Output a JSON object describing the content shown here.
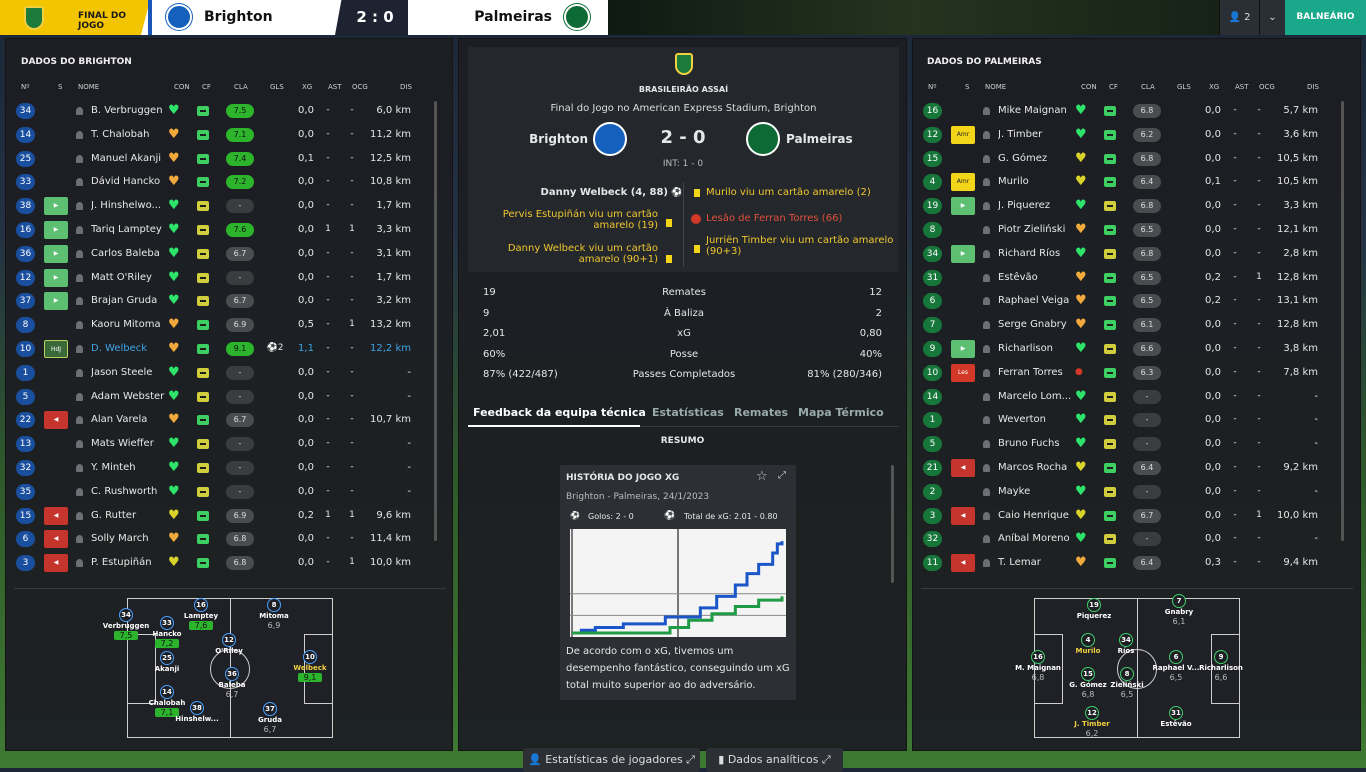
{
  "topbar": {
    "league_label": "FINAL DO JOGO",
    "home": "Brighton",
    "score": "2 : 0",
    "away": "Palmeiras",
    "user_count": "2",
    "balneario": "BALNEÁRIO"
  },
  "colors": {
    "home": "#1560bd",
    "away": "#0d6a35",
    "accent": "#19a88a",
    "league": "#f3c400"
  },
  "home_panel": {
    "title": "DADOS DO BRIGHTON",
    "headers": [
      "Nº",
      "S",
      "NOME",
      "CON",
      "CF",
      "CLA",
      "GLS",
      "XG",
      "AST",
      "OCG",
      "DIS"
    ],
    "rows": [
      {
        "num": "34",
        "sub": "",
        "name": "B. Verbruggen",
        "con": "g",
        "cf": "g",
        "cla": "7.5",
        "gls": "",
        "xg": "0,0",
        "ast": "-",
        "ocg": "-",
        "dis": "6,0 km"
      },
      {
        "num": "14",
        "sub": "",
        "name": "T. Chalobah",
        "con": "o",
        "cf": "g",
        "cla": "7.1",
        "gls": "",
        "xg": "0,0",
        "ast": "-",
        "ocg": "-",
        "dis": "11,2 km"
      },
      {
        "num": "25",
        "sub": "",
        "name": "Manuel Akanji",
        "con": "o",
        "cf": "g",
        "cla": "7.4",
        "gls": "",
        "xg": "0,1",
        "ast": "-",
        "ocg": "-",
        "dis": "12,5 km"
      },
      {
        "num": "33",
        "sub": "",
        "name": "Dávid Hancko",
        "con": "o",
        "cf": "g",
        "cla": "7.2",
        "gls": "",
        "xg": "0,0",
        "ast": "-",
        "ocg": "-",
        "dis": "10,8 km"
      },
      {
        "num": "38",
        "sub": "in",
        "name": "J. Hinshelwo...",
        "con": "g",
        "cf": "y",
        "cla": "-",
        "gls": "",
        "xg": "0,0",
        "ast": "-",
        "ocg": "-",
        "dis": "1,7 km"
      },
      {
        "num": "16",
        "sub": "in",
        "name": "Tariq Lamptey",
        "con": "g",
        "cf": "y",
        "cla": "7.6",
        "gls": "",
        "xg": "0,0",
        "ast": "1",
        "ocg": "1",
        "dis": "3,3 km"
      },
      {
        "num": "36",
        "sub": "in",
        "name": "Carlos Baleba",
        "con": "g",
        "cf": "y",
        "cla": "6.7",
        "gls": "",
        "xg": "0,0",
        "ast": "-",
        "ocg": "-",
        "dis": "3,1 km"
      },
      {
        "num": "12",
        "sub": "in",
        "name": "Matt O'Riley",
        "con": "g",
        "cf": "y",
        "cla": "-",
        "gls": "",
        "xg": "0,0",
        "ast": "-",
        "ocg": "-",
        "dis": "1,7 km"
      },
      {
        "num": "37",
        "sub": "in",
        "name": "Brajan Gruda",
        "con": "g",
        "cf": "y",
        "cla": "6.7",
        "gls": "",
        "xg": "0,0",
        "ast": "-",
        "ocg": "-",
        "dis": "3,2 km"
      },
      {
        "num": "8",
        "sub": "",
        "name": "Kaoru Mitoma",
        "con": "o",
        "cf": "g",
        "cla": "6.9",
        "gls": "",
        "xg": "0,5",
        "ast": "-",
        "ocg": "1",
        "dis": "13,2 km"
      },
      {
        "num": "10",
        "sub": "hdj",
        "name": "D. Welbeck",
        "con": "o",
        "cf": "g",
        "cla": "9.1",
        "gls": "2",
        "xg": "1,1",
        "ast": "-",
        "ocg": "-",
        "dis": "12,2 km",
        "hl": true
      },
      {
        "num": "1",
        "sub": "",
        "name": "Jason Steele",
        "con": "g",
        "cf": "y",
        "cla": "-",
        "gls": "",
        "xg": "0,0",
        "ast": "-",
        "ocg": "-",
        "dis": "-"
      },
      {
        "num": "5",
        "sub": "",
        "name": "Adam Webster",
        "con": "g",
        "cf": "y",
        "cla": "-",
        "gls": "",
        "xg": "0,0",
        "ast": "-",
        "ocg": "-",
        "dis": "-"
      },
      {
        "num": "22",
        "sub": "out",
        "name": "Alan Varela",
        "con": "o",
        "cf": "g",
        "cla": "6.7",
        "gls": "",
        "xg": "0,0",
        "ast": "-",
        "ocg": "-",
        "dis": "10,7 km"
      },
      {
        "num": "13",
        "sub": "",
        "name": "Mats Wieffer",
        "con": "g",
        "cf": "y",
        "cla": "-",
        "gls": "",
        "xg": "0,0",
        "ast": "-",
        "ocg": "-",
        "dis": "-"
      },
      {
        "num": "32",
        "sub": "",
        "name": "Y. Minteh",
        "con": "g",
        "cf": "y",
        "cla": "-",
        "gls": "",
        "xg": "0,0",
        "ast": "-",
        "ocg": "-",
        "dis": "-"
      },
      {
        "num": "35",
        "sub": "",
        "name": "C. Rushworth",
        "con": "g",
        "cf": "y",
        "cla": "-",
        "gls": "",
        "xg": "0,0",
        "ast": "-",
        "ocg": "-",
        "dis": "-"
      },
      {
        "num": "15",
        "sub": "out",
        "name": "G. Rutter",
        "con": "y",
        "cf": "g",
        "cla": "6.9",
        "gls": "",
        "xg": "0,2",
        "ast": "1",
        "ocg": "1",
        "dis": "9,6 km"
      },
      {
        "num": "6",
        "sub": "out",
        "name": "Solly March",
        "con": "o",
        "cf": "g",
        "cla": "6.8",
        "gls": "",
        "xg": "0,0",
        "ast": "-",
        "ocg": "-",
        "dis": "11,4 km"
      },
      {
        "num": "3",
        "sub": "out",
        "name": "P. Estupiñán",
        "con": "y",
        "cf": "g",
        "cla": "6.8",
        "gls": "",
        "xg": "0,0",
        "ast": "-",
        "ocg": "1",
        "dis": "10,0 km"
      }
    ],
    "formation": [
      {
        "num": "34",
        "name": "Verbruggen",
        "rating": "7,5"
      },
      {
        "num": "33",
        "name": "Hancko",
        "rating": "7,2"
      },
      {
        "num": "25",
        "name": "Akanji",
        "rating": ""
      },
      {
        "num": "14",
        "name": "Chalobah",
        "rating": "7,1"
      },
      {
        "num": "16",
        "name": "Lamptey",
        "rating": "7,6"
      },
      {
        "num": "38",
        "name": "Hinshelw...",
        "rating": ""
      },
      {
        "num": "12",
        "name": "O'Riley",
        "rating": ""
      },
      {
        "num": "36",
        "name": "Baleba",
        "rating": "6,7"
      },
      {
        "num": "8",
        "name": "Mitoma",
        "rating": "6,9"
      },
      {
        "num": "37",
        "name": "Gruda",
        "rating": "6,7"
      },
      {
        "num": "10",
        "name": "Welbeck",
        "rating": "9,1"
      }
    ]
  },
  "center": {
    "competition": "BRASILEIRÃO ASSAÍ",
    "venue": "Final do Jogo no American Express Stadium, Brighton",
    "home": "Brighton",
    "away": "Palmeiras",
    "score": "2 - 0",
    "ht": "INT: 1 - 0",
    "events_home": [
      "Danny Welbeck (4, 88)",
      "Pervis Estupiñán viu um cartão amarelo (19)",
      "Danny Welbeck viu um cartão amarelo (90+1)"
    ],
    "events_away": [
      "Murilo viu um cartão amarelo (2)",
      "Lesão de Ferran Torres (66)",
      "Jurriën Timber viu um cartão amarelo (90+3)"
    ],
    "stats": [
      {
        "home": "19",
        "label": "Remates",
        "away": "12"
      },
      {
        "home": "9",
        "label": "À Baliza",
        "away": "2"
      },
      {
        "home": "2,01",
        "label": "xG",
        "away": "0,80"
      },
      {
        "home": "60%",
        "label": "Posse",
        "away": "40%"
      },
      {
        "home": "87% (422/487)",
        "label": "Passes Completados",
        "away": "81% (280/346)"
      }
    ],
    "tabs": [
      "Feedback da equipa técnica",
      "Estatísticas",
      "Remates",
      "Mapa Térmico"
    ],
    "resumo": "RESUMO",
    "card": {
      "title": "HISTÓRIA DO JOGO XG",
      "subtitle": "Brighton - Palmeiras, 24/1/2023",
      "goals": "Golos: 2 - 0",
      "xg_total": "Total de xG: 2.01 - 0.80",
      "text": "De acordo com o xG, tivemos um desempenho fantástico, conseguindo um xG total muito superior ao do adversário."
    },
    "buttons": [
      "Estatísticas de jogadores",
      "Dados analíticos"
    ]
  },
  "chart_data": {
    "type": "line",
    "series": [
      {
        "color": "#1a56c8",
        "x": [
          0,
          4,
          10,
          22,
          40,
          55,
          62,
          70,
          75,
          80,
          86,
          88,
          90
        ],
        "y": [
          0.0,
          0.06,
          0.12,
          0.2,
          0.35,
          0.55,
          0.8,
          1.05,
          1.3,
          1.5,
          1.75,
          1.95,
          2.01
        ]
      },
      {
        "color": "#1f9a45",
        "x": [
          0,
          20,
          42,
          50,
          60,
          70,
          80,
          90
        ],
        "y": [
          0.0,
          0.0,
          0.12,
          0.28,
          0.42,
          0.58,
          0.72,
          0.8
        ]
      }
    ]
  },
  "away_panel": {
    "title": "DADOS DO PALMEIRAS",
    "headers": [
      "Nº",
      "S",
      "NOME",
      "CON",
      "CF",
      "CLA",
      "GLS",
      "XG",
      "AST",
      "OCG",
      "DIS"
    ],
    "rows": [
      {
        "num": "16",
        "sub": "",
        "name": "Mike Maignan",
        "con": "g",
        "cf": "g",
        "cla": "6.8",
        "xg": "0,0",
        "ast": "-",
        "ocg": "-",
        "dis": "5,7 km"
      },
      {
        "num": "12",
        "sub": "amr",
        "name": "J. Timber",
        "con": "g",
        "cf": "g",
        "cla": "6.2",
        "xg": "0,0",
        "ast": "-",
        "ocg": "-",
        "dis": "3,6 km"
      },
      {
        "num": "15",
        "sub": "",
        "name": "G. Gómez",
        "con": "y",
        "cf": "g",
        "cla": "6.8",
        "xg": "0,0",
        "ast": "-",
        "ocg": "-",
        "dis": "10,5 km"
      },
      {
        "num": "4",
        "sub": "amr",
        "name": "Murilo",
        "con": "y",
        "cf": "g",
        "cla": "6.4",
        "xg": "0,1",
        "ast": "-",
        "ocg": "-",
        "dis": "10,5 km"
      },
      {
        "num": "19",
        "sub": "in",
        "name": "J. Piquerez",
        "con": "g",
        "cf": "y",
        "cla": "6.8",
        "xg": "0,0",
        "ast": "-",
        "ocg": "-",
        "dis": "3,3 km"
      },
      {
        "num": "8",
        "sub": "",
        "name": "Piotr Zieliński",
        "con": "o",
        "cf": "g",
        "cla": "6.5",
        "xg": "0,0",
        "ast": "-",
        "ocg": "-",
        "dis": "12,1 km"
      },
      {
        "num": "34",
        "sub": "in",
        "name": "Richard Ríos",
        "con": "g",
        "cf": "y",
        "cla": "6.8",
        "xg": "0,0",
        "ast": "-",
        "ocg": "-",
        "dis": "2,8 km"
      },
      {
        "num": "31",
        "sub": "",
        "name": "Estêvão",
        "con": "o",
        "cf": "g",
        "cla": "6.5",
        "xg": "0,2",
        "ast": "-",
        "ocg": "1",
        "dis": "12,8 km"
      },
      {
        "num": "6",
        "sub": "",
        "name": "Raphael Veiga",
        "con": "o",
        "cf": "g",
        "cla": "6.5",
        "xg": "0,2",
        "ast": "-",
        "ocg": "-",
        "dis": "13,1 km"
      },
      {
        "num": "7",
        "sub": "",
        "name": "Serge Gnabry",
        "con": "o",
        "cf": "g",
        "cla": "6.1",
        "xg": "0,0",
        "ast": "-",
        "ocg": "-",
        "dis": "12,8 km"
      },
      {
        "num": "9",
        "sub": "in",
        "name": "Richarlison",
        "con": "g",
        "cf": "y",
        "cla": "6.6",
        "xg": "0,0",
        "ast": "-",
        "ocg": "-",
        "dis": "3,8 km"
      },
      {
        "num": "10",
        "sub": "les",
        "name": "Ferran Torres",
        "con": "r",
        "cf": "g",
        "cla": "6.3",
        "xg": "0,0",
        "ast": "-",
        "ocg": "-",
        "dis": "7,8 km"
      },
      {
        "num": "14",
        "sub": "",
        "name": "Marcelo Lom...",
        "con": "g",
        "cf": "y",
        "cla": "-",
        "xg": "0,0",
        "ast": "-",
        "ocg": "-",
        "dis": "-"
      },
      {
        "num": "1",
        "sub": "",
        "name": "Weverton",
        "con": "g",
        "cf": "y",
        "cla": "-",
        "xg": "0,0",
        "ast": "-",
        "ocg": "-",
        "dis": "-"
      },
      {
        "num": "5",
        "sub": "",
        "name": "Bruno Fuchs",
        "con": "g",
        "cf": "y",
        "cla": "-",
        "xg": "0,0",
        "ast": "-",
        "ocg": "-",
        "dis": "-"
      },
      {
        "num": "21",
        "sub": "out",
        "name": "Marcos Rocha",
        "con": "y",
        "cf": "g",
        "cla": "6.4",
        "xg": "0,0",
        "ast": "-",
        "ocg": "-",
        "dis": "9,2 km"
      },
      {
        "num": "2",
        "sub": "",
        "name": "Mayke",
        "con": "g",
        "cf": "y",
        "cla": "-",
        "xg": "0,0",
        "ast": "-",
        "ocg": "-",
        "dis": "-"
      },
      {
        "num": "3",
        "sub": "out",
        "name": "Caio Henrique",
        "con": "y",
        "cf": "g",
        "cla": "6.7",
        "xg": "0,0",
        "ast": "-",
        "ocg": "1",
        "dis": "10,0 km"
      },
      {
        "num": "32",
        "sub": "",
        "name": "Aníbal Moreno",
        "con": "g",
        "cf": "y",
        "cla": "-",
        "xg": "0,0",
        "ast": "-",
        "ocg": "-",
        "dis": "-"
      },
      {
        "num": "11",
        "sub": "out",
        "name": "T. Lemar",
        "con": "o",
        "cf": "g",
        "cla": "6.4",
        "xg": "0,3",
        "ast": "-",
        "ocg": "-",
        "dis": "9,4 km"
      }
    ],
    "formation": [
      {
        "num": "16",
        "name": "M. Maignan",
        "rating": "6,8"
      },
      {
        "num": "19",
        "name": "Piquerez",
        "rating": ""
      },
      {
        "num": "4",
        "name": "Murilo",
        "rating": ""
      },
      {
        "num": "15",
        "name": "G. Gómez",
        "rating": "6,8"
      },
      {
        "num": "12",
        "name": "J. Timber",
        "rating": "6,2"
      },
      {
        "num": "34",
        "name": "Ríos",
        "rating": ""
      },
      {
        "num": "8",
        "name": "Zieliński",
        "rating": "6,5"
      },
      {
        "num": "7",
        "name": "Gnabry",
        "rating": "6,1"
      },
      {
        "num": "6",
        "name": "Raphael V...",
        "rating": "6,5"
      },
      {
        "num": "9",
        "name": "Richarlison",
        "rating": "6,6"
      },
      {
        "num": "31",
        "name": "Estêvão",
        "rating": ""
      }
    ]
  }
}
